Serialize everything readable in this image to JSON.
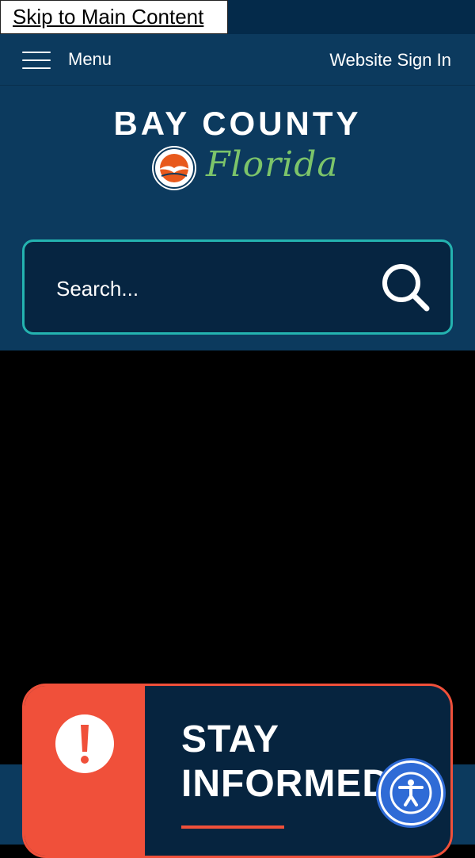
{
  "skip_link": {
    "label": "Skip to Main Content"
  },
  "nav": {
    "menu_label": "Menu",
    "signin_label": "Website Sign In"
  },
  "brand": {
    "title": "BAY COUNTY",
    "subtitle": "Florida"
  },
  "search": {
    "placeholder": "Search..."
  },
  "alert": {
    "heading_line1": "STAY",
    "heading_line2": "INFORMED"
  },
  "colors": {
    "nav_bg": "#0c3a5e",
    "search_border": "#24b3b0",
    "alert_accent": "#f0503a",
    "florida_green": "#7cc46a",
    "a11y_blue": "#2f6bd6"
  },
  "icons": {
    "menu": "hamburger-icon",
    "search": "search-icon",
    "alert": "exclamation-icon",
    "seal": "county-seal-icon",
    "accessibility": "accessibility-icon"
  }
}
